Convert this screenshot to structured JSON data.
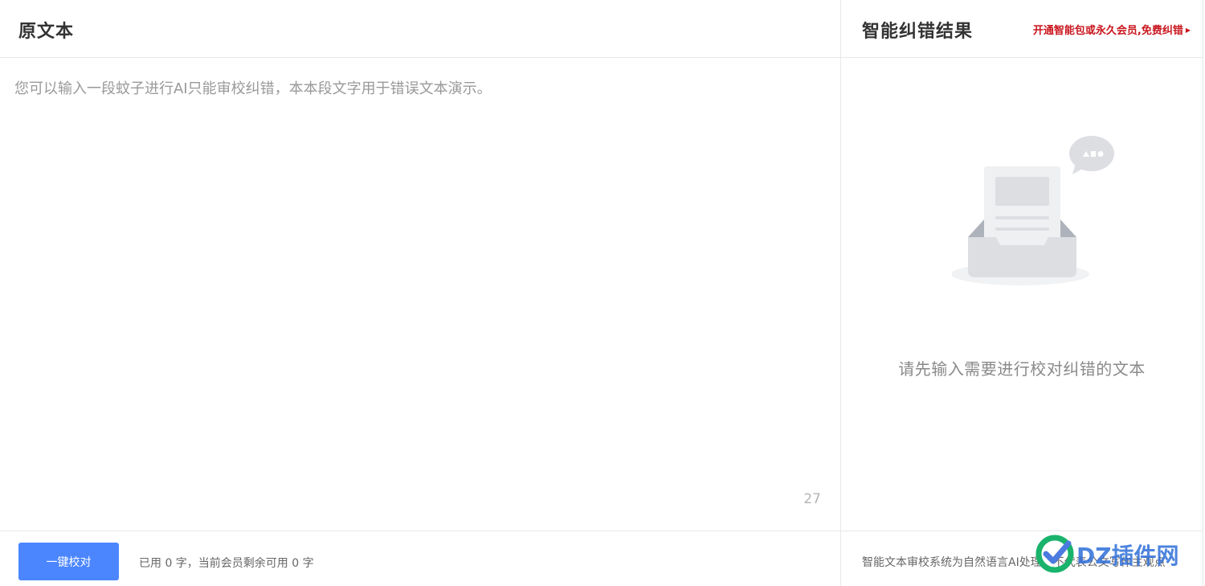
{
  "left_panel": {
    "title": "原文本",
    "editor_placeholder": "您可以输入一段蚊子进行AI只能审校纠错，本本段文字用于错误文本演示。",
    "editor_value": "",
    "char_count": "27",
    "proof_button_label": "一键校对",
    "usage_text": "已用 0 字，当前会员剩余可用 0 字"
  },
  "right_panel": {
    "title": "智能纠错结果",
    "promo_label": "开通智能包或永久会员,免费纠错",
    "promo_arrow_icon": "triangle-right-icon",
    "empty_text": "请先输入需要进行校对纠错的文本",
    "disclaimer": "智能文本审校系统为自然语言AI处理，不代表公文写作主观点"
  },
  "watermark": {
    "text": "DZ插件网",
    "icon": "check-circle-logo"
  },
  "colors": {
    "accent_blue": "#4b86ff",
    "promo_red": "#c9161e",
    "border": "#e8e8e8"
  }
}
